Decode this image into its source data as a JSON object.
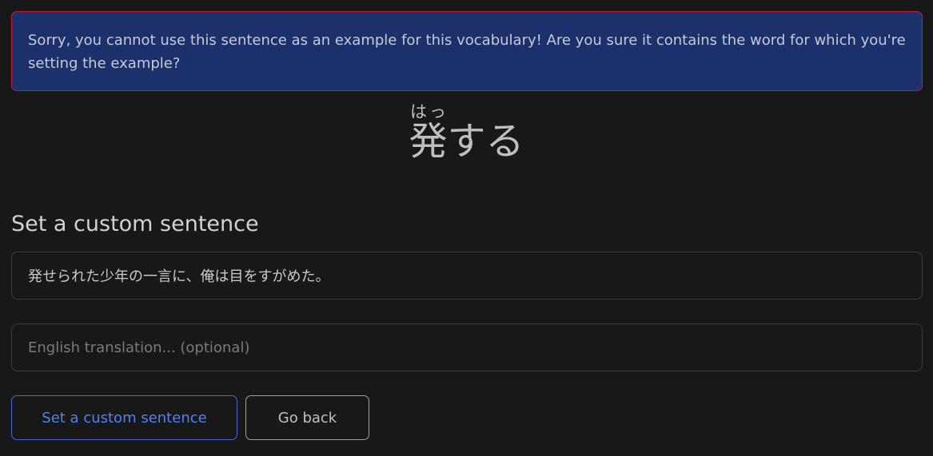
{
  "alert": {
    "message": "Sorry, you cannot use this sentence as an example for this vocabulary! Are you sure it contains the word for which you're setting the example?",
    "background_color": "#1c316b",
    "border_color": "#c1233c"
  },
  "vocab": {
    "kanji": "発",
    "reading": "はっ",
    "okurigana": "する"
  },
  "section": {
    "title": "Set a custom sentence"
  },
  "form": {
    "sentence_value": "発せられた少年の一言に、俺は目をすがめた。",
    "translation_value": "",
    "translation_placeholder": "English translation... (optional)"
  },
  "buttons": {
    "submit_label": "Set a custom sentence",
    "back_label": "Go back",
    "primary_color": "#4d84f1"
  }
}
